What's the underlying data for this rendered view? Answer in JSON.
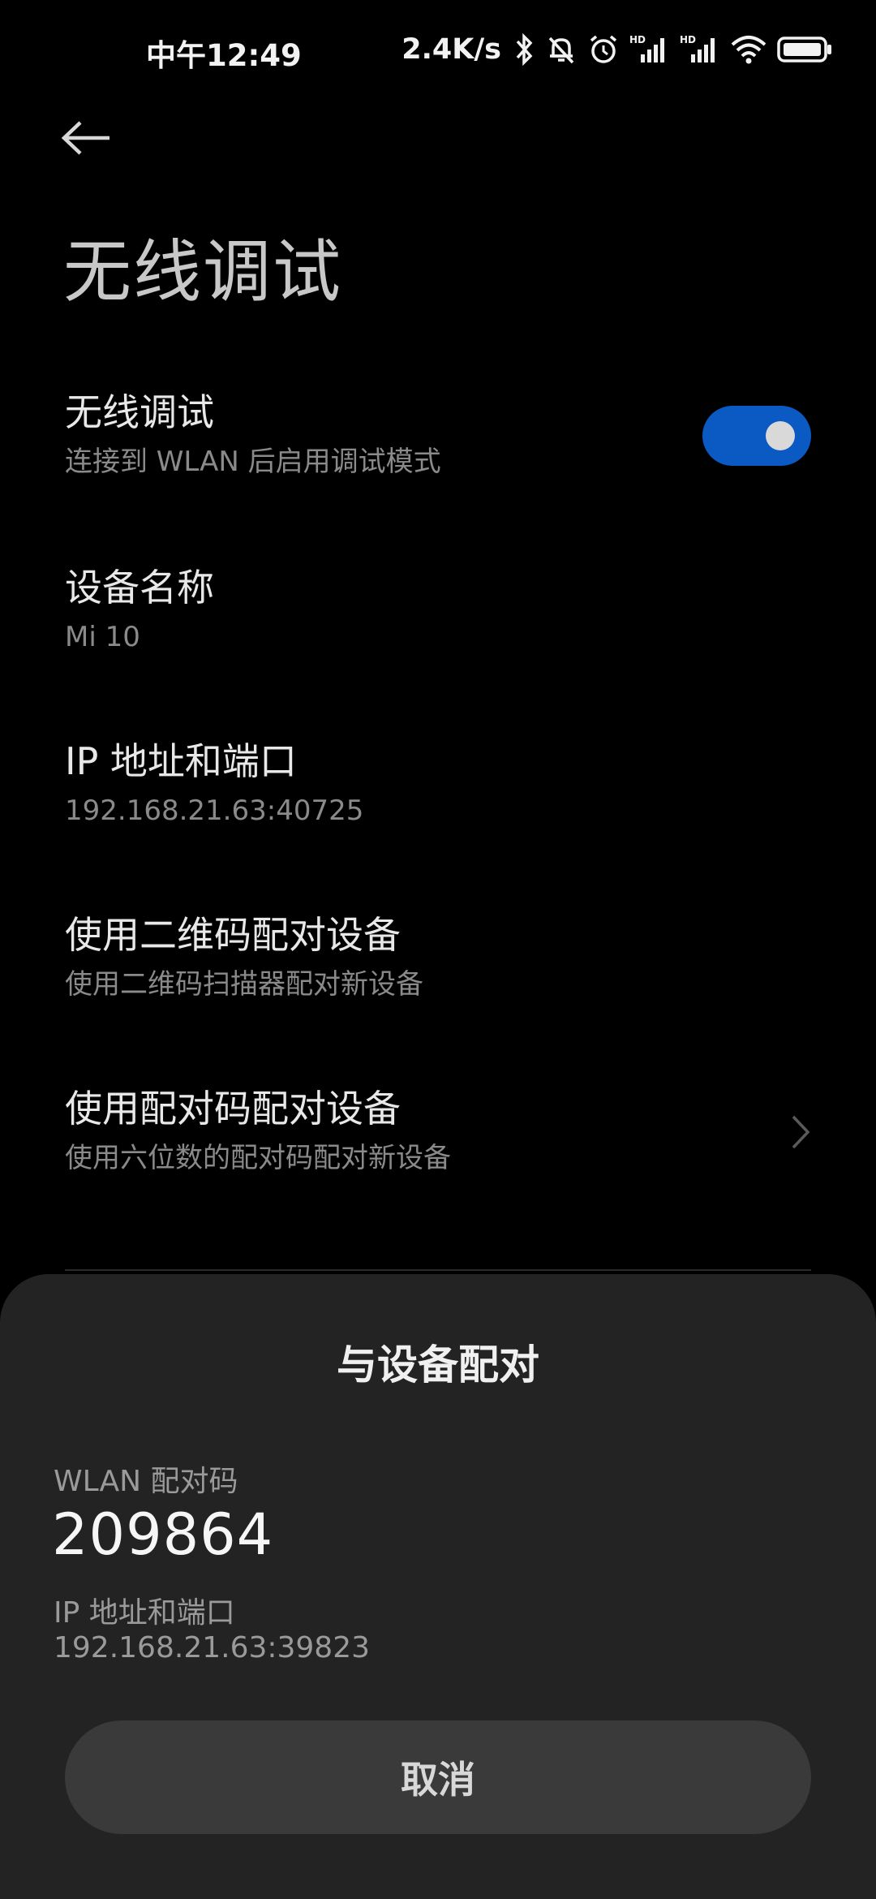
{
  "status_bar": {
    "time": "中午12:49",
    "speed": "2.4K/s",
    "icons": [
      "bluetooth-icon",
      "silent-bell-icon",
      "alarm-icon",
      "hd-signal-icon",
      "hd-signal-icon",
      "wifi-icon",
      "battery-icon"
    ],
    "hd_label": "HD"
  },
  "header": {
    "title": "无线调试"
  },
  "settings": {
    "wireless_debugging": {
      "title": "无线调试",
      "subtitle": "连接到 WLAN 后启用调试模式",
      "enabled": true
    },
    "device_name": {
      "title": "设备名称",
      "value": "Mi 10"
    },
    "ip_port": {
      "title": "IP 地址和端口",
      "value": "192.168.21.63:40725"
    },
    "qr_pair": {
      "title": "使用二维码配对设备",
      "subtitle": "使用二维码扫描器配对新设备"
    },
    "code_pair": {
      "title": "使用配对码配对设备",
      "subtitle": "使用六位数的配对码配对新设备"
    }
  },
  "dialog": {
    "title": "与设备配对",
    "code_label": "WLAN 配对码",
    "code": "209864",
    "ip_label": "IP 地址和端口",
    "ip_value": "192.168.21.63:39823",
    "cancel_label": "取消"
  },
  "colors": {
    "background": "#000000",
    "toggle_on": "#0b59c2",
    "sheet": "#232323",
    "button": "#3a3a3a"
  }
}
